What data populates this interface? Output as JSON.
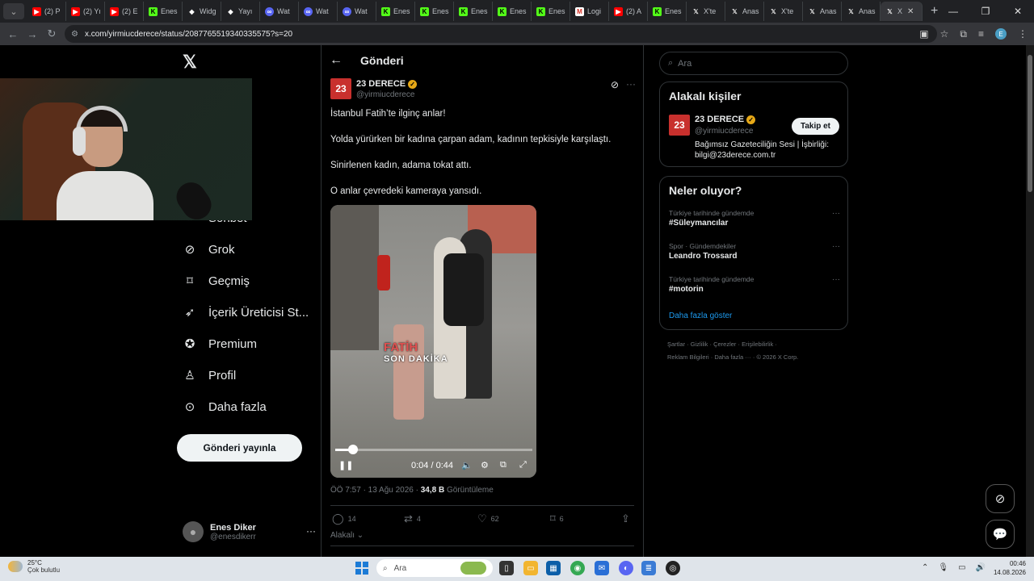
{
  "browser": {
    "tabs": [
      {
        "icon": "youtube-icon",
        "label": "(2) P"
      },
      {
        "icon": "youtube-icon",
        "label": "(2) Yı"
      },
      {
        "icon": "youtube-icon",
        "label": "(2) E"
      },
      {
        "icon": "kick-icon",
        "label": "Enes"
      },
      {
        "icon": "widget-icon",
        "label": "Widg"
      },
      {
        "icon": "widget-icon",
        "label": "Yayı"
      },
      {
        "icon": "watch-icon",
        "label": "Wat"
      },
      {
        "icon": "watch-icon",
        "label": "Wat"
      },
      {
        "icon": "watch-icon",
        "label": "Wat"
      },
      {
        "icon": "kick-icon",
        "label": "Enes"
      },
      {
        "icon": "kick-icon",
        "label": "Enes"
      },
      {
        "icon": "kick-icon",
        "label": "Enes"
      },
      {
        "icon": "kick-icon",
        "label": "Enes"
      },
      {
        "icon": "kick-icon",
        "label": "Enes"
      },
      {
        "icon": "gmail-icon",
        "label": "Logi"
      },
      {
        "icon": "youtube-icon",
        "label": "(2) A"
      },
      {
        "icon": "kick-icon",
        "label": "Enes"
      },
      {
        "icon": "x-icon",
        "label": "X'te"
      },
      {
        "icon": "x-icon",
        "label": "Anas"
      },
      {
        "icon": "x-icon",
        "label": "X'te"
      },
      {
        "icon": "x-icon",
        "label": "Anas"
      },
      {
        "icon": "x-icon",
        "label": "Anas"
      },
      {
        "icon": "x-icon",
        "label": "X"
      }
    ],
    "url": "x.com/yirmiucderece/status/2087765519340335575?s=20"
  },
  "nav": {
    "items": [
      {
        "label": "Sohbet",
        "icon": "chat-icon"
      },
      {
        "label": "Grok",
        "icon": "grok-icon"
      },
      {
        "label": "Geçmiş",
        "icon": "bookmark-icon"
      },
      {
        "label": "İçerik Üreticisi St...",
        "icon": "rocket-icon"
      },
      {
        "label": "Premium",
        "icon": "premium-icon"
      },
      {
        "label": "Profil",
        "icon": "profile-icon"
      },
      {
        "label": "Daha fazla",
        "icon": "more-circle-icon"
      }
    ],
    "post_button": "Gönderi yayınla",
    "account": {
      "name": "Enes Diker",
      "handle": "@enesdikerr"
    }
  },
  "post": {
    "header_title": "Gönderi",
    "author_name": "23 DERECE",
    "author_handle": "@yirmiucderece",
    "avatar_text": "23",
    "paragraphs": [
      "İstanbul Fatih’te ilginç anlar!",
      "Yolda yürürken bir kadına çarpan adam, kadının tepkisiyle karşılaştı.",
      "Sinirlenen kadın, adama tokat attı.",
      "O anlar çevredeki kameraya yansıdı."
    ],
    "video": {
      "overlay_line1": "FATİH",
      "overlay_line2": "SON DAKİKA",
      "time": "0:04 / 0:44",
      "progress": 0.09
    },
    "meta_time": "ÖÖ 7:57 · 13 Ağu 2026 · ",
    "views": "34,8 B",
    "views_label": " Görüntüleme",
    "stats": {
      "replies": "14",
      "reposts": "4",
      "likes": "62",
      "bookmarks": "6"
    },
    "related_label": "Alakalı"
  },
  "sidebar": {
    "search_placeholder": "Ara",
    "related_title": "Alakalı kişiler",
    "related_person": {
      "name": "23 DERECE",
      "handle": "@yirmiucderece",
      "bio": "Bağımsız Gazeteciliğin Sesi | İşbirliği: bilgi@23derece.com.tr",
      "follow_label": "Takip et"
    },
    "trends_title": "Neler oluyor?",
    "trends": [
      {
        "context": "Türkiye tarihinde gündemde",
        "name": "#Süleymancılar"
      },
      {
        "context": "Spor · Gündemdekiler",
        "name": "Leandro Trossard"
      },
      {
        "context": "Türkiye tarihinde gündemde",
        "name": "#motorin"
      }
    ],
    "show_more": "Daha fazla göster",
    "footer_line1": "Şartlar  ·  Gizlilik  ·  Çerezler  ·  Erişilebilirlik  ·",
    "footer_line2": "Reklam Bilgileri  ·  Daha fazla ···  ·  © 2026 X Corp."
  },
  "taskbar": {
    "temp": "25°C",
    "weather": "Çok bulutlu",
    "search_placeholder": "Ara",
    "time": "00:46",
    "date": "14.08.2026"
  },
  "colors": {
    "accent": "#1d9bf0",
    "brand_red": "#c8302d",
    "verified": "#e6a817"
  }
}
